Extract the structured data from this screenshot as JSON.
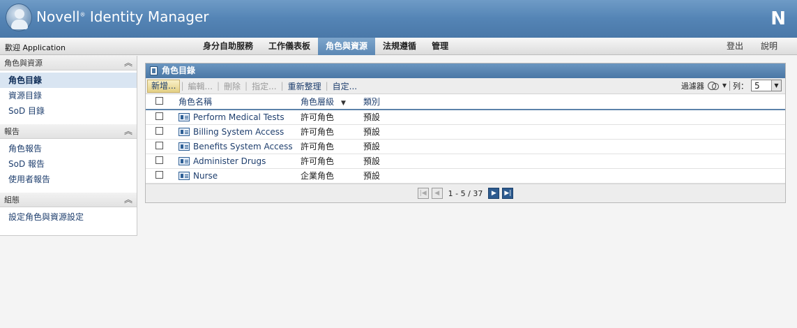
{
  "header": {
    "brand": "Novell",
    "brand_mark": "®",
    "product": "Identity Manager",
    "logo_letter": "N"
  },
  "navbar": {
    "welcome": "歡迎 Application",
    "tabs": [
      {
        "label": "身分自助服務"
      },
      {
        "label": "工作儀表板"
      },
      {
        "label": "角色與資源"
      },
      {
        "label": "法規遵循"
      },
      {
        "label": "管理"
      }
    ],
    "active_tab": "角色與資源",
    "logout": "登出",
    "help": "說明"
  },
  "sidebar": {
    "sections": [
      {
        "title": "角色與資源",
        "items": [
          "角色目錄",
          "資源目錄",
          "SoD 目錄"
        ]
      },
      {
        "title": "報告",
        "items": [
          "角色報告",
          "SoD 報告",
          "使用者報告"
        ]
      },
      {
        "title": "組態",
        "items": [
          "設定角色與資源設定"
        ]
      }
    ],
    "selected_item": "角色目錄"
  },
  "panel": {
    "title": "角色目錄",
    "toolbar": {
      "new": "新增...",
      "edit": "編輯...",
      "delete": "刪除",
      "assign": "指定...",
      "refresh": "重新整理",
      "customize": "自定...",
      "filter_label": "過濾器",
      "rows_label": "列：",
      "rows_value": "5"
    },
    "columns": {
      "name": "角色名稱",
      "level": "角色層級",
      "category": "類別"
    },
    "rows": [
      {
        "name": "Perform Medical Tests",
        "level": "許可角色",
        "category": "預設"
      },
      {
        "name": "Billing System Access",
        "level": "許可角色",
        "category": "預設"
      },
      {
        "name": "Benefits System Access",
        "level": "許可角色",
        "category": "預設"
      },
      {
        "name": "Administer Drugs",
        "level": "許可角色",
        "category": "預設"
      },
      {
        "name": "Nurse",
        "level": "企業角色",
        "category": "預設"
      }
    ],
    "pager": {
      "text": "1 - 5 / 37"
    }
  },
  "colors": {
    "header_blue": "#5484b5",
    "active_tab": "#5b87b4",
    "link": "#1f3f6e",
    "selected_bg": "#d9e5f2"
  }
}
